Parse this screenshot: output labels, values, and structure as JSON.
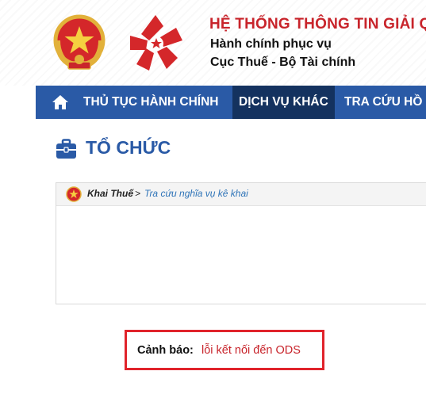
{
  "header": {
    "title": "HỆ THỐNG THÔNG TIN GIẢI QUYẾT",
    "subtitle_line1": "Hành chính phục vụ",
    "subtitle_line2": "Cục Thuế - Bộ Tài chính"
  },
  "nav": {
    "home_icon": "home-icon",
    "items": [
      {
        "label": "THỦ TỤC HÀNH CHÍNH",
        "active": false
      },
      {
        "label": "DỊCH VỤ KHÁC",
        "active": true
      },
      {
        "label": "TRA CỨU HỒ SƠ",
        "active": false
      }
    ]
  },
  "page": {
    "heading": "TỔ CHỨC",
    "heading_icon": "briefcase-icon"
  },
  "breadcrumb": {
    "home": "Khai Thuế",
    "separator": ">",
    "current": "Tra cứu nghĩa vụ kê khai"
  },
  "warning": {
    "label": "Cảnh báo:",
    "message": "lỗi kết nối đến ODS"
  },
  "colors": {
    "title_red": "#c8242b",
    "nav_blue": "#2a5aa6",
    "nav_active": "#14325f",
    "heading_blue": "#2a5aa6",
    "warning_border": "#e0232b",
    "link_blue": "#2f74b8"
  }
}
